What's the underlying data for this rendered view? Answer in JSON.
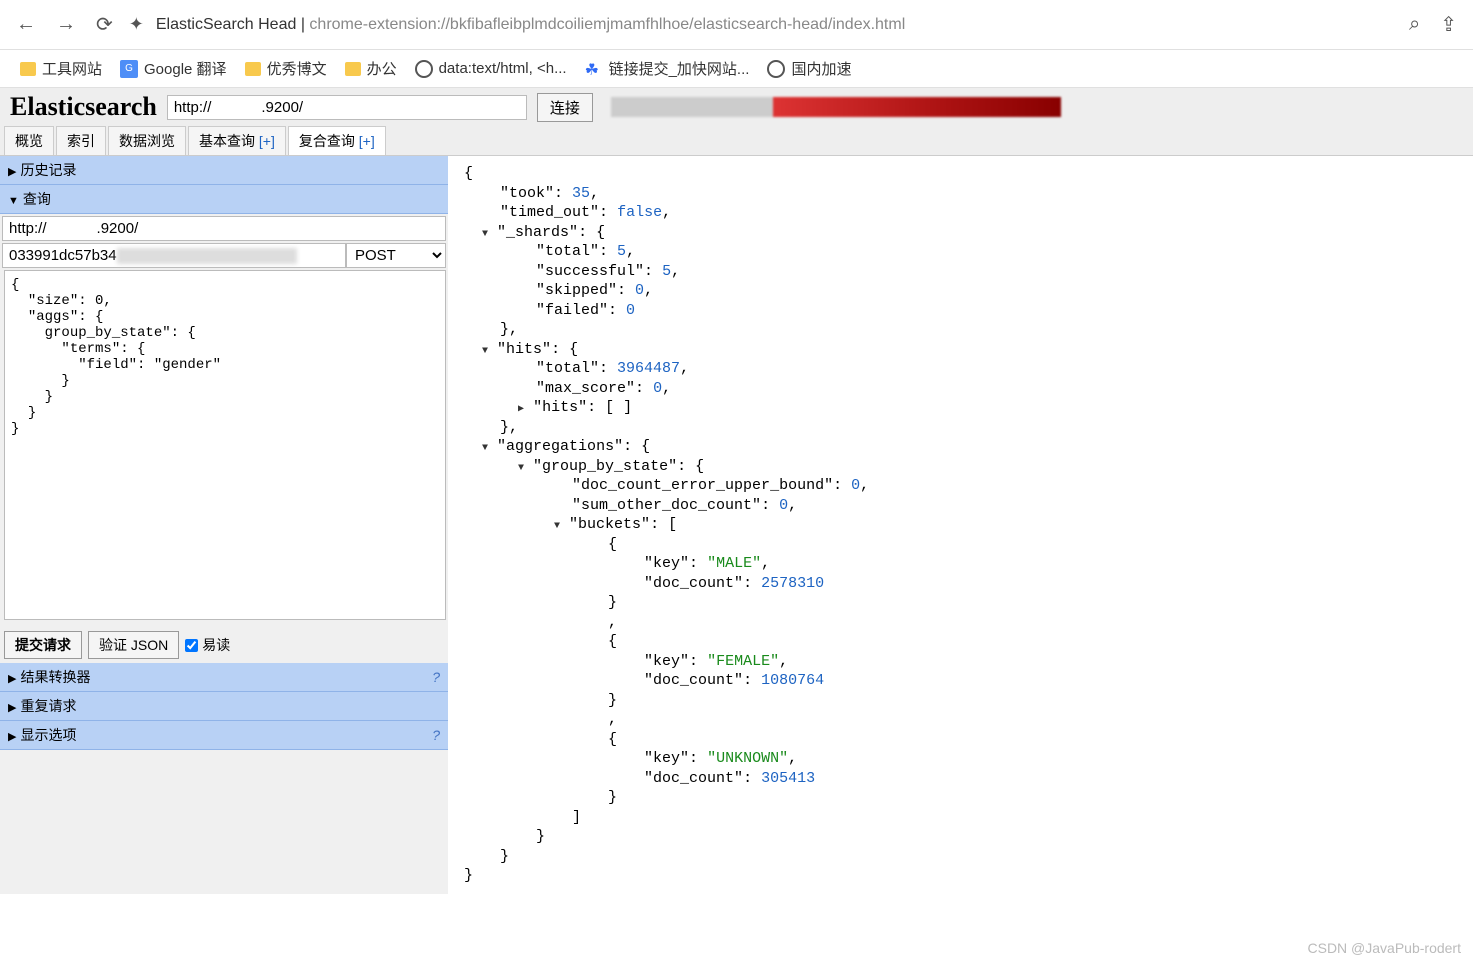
{
  "browser": {
    "title": "ElasticSearch Head",
    "url_path": "chrome-extension://bkfibafleibplmdcoiliemjmamfhlhoe/elasticsearch-head/index.html"
  },
  "bookmarks": [
    "工具网站",
    "Google 翻译",
    "优秀博文",
    "办公",
    "data:text/html, <h...",
    "链接提交_加快网站...",
    "国内加速"
  ],
  "app": {
    "title": "Elasticsearch",
    "conn_url": "http://            .9200/",
    "conn_btn": "连接"
  },
  "tabs": {
    "t0": "概览",
    "t1": "索引",
    "t2": "数据浏览",
    "t3": "基本查询",
    "t4": "复合查询",
    "plus": "[+]"
  },
  "sections": {
    "history": "历史记录",
    "query": "查询",
    "result_trans": "结果转换器",
    "repeat": "重复请求",
    "display": "显示选项"
  },
  "query": {
    "url": "http://            .9200/",
    "index": "033991dc57b34",
    "method": "POST",
    "body": "{\n  \"size\": 0,\n  \"aggs\": {\n    group_by_state\": {\n      \"terms\": {\n        \"field\": \"gender\"\n      }\n    }\n  }\n}"
  },
  "actions": {
    "submit": "提交请求",
    "validate": "验证 JSON",
    "easy_read": "易读"
  },
  "response": {
    "took": 35,
    "timed_out": "false",
    "shards": {
      "total": 5,
      "successful": 5,
      "skipped": 0,
      "failed": 0
    },
    "hits": {
      "total": 3964487,
      "max_score": 0
    },
    "aggs": {
      "doc_count_error_upper_bound": 0,
      "sum_other_doc_count": 0,
      "buckets": [
        {
          "key": "MALE",
          "doc_count": 2578310
        },
        {
          "key": "FEMALE",
          "doc_count": 1080764
        },
        {
          "key": "UNKNOWN",
          "doc_count": 305413
        }
      ]
    }
  },
  "watermark": "CSDN @JavaPub-rodert"
}
